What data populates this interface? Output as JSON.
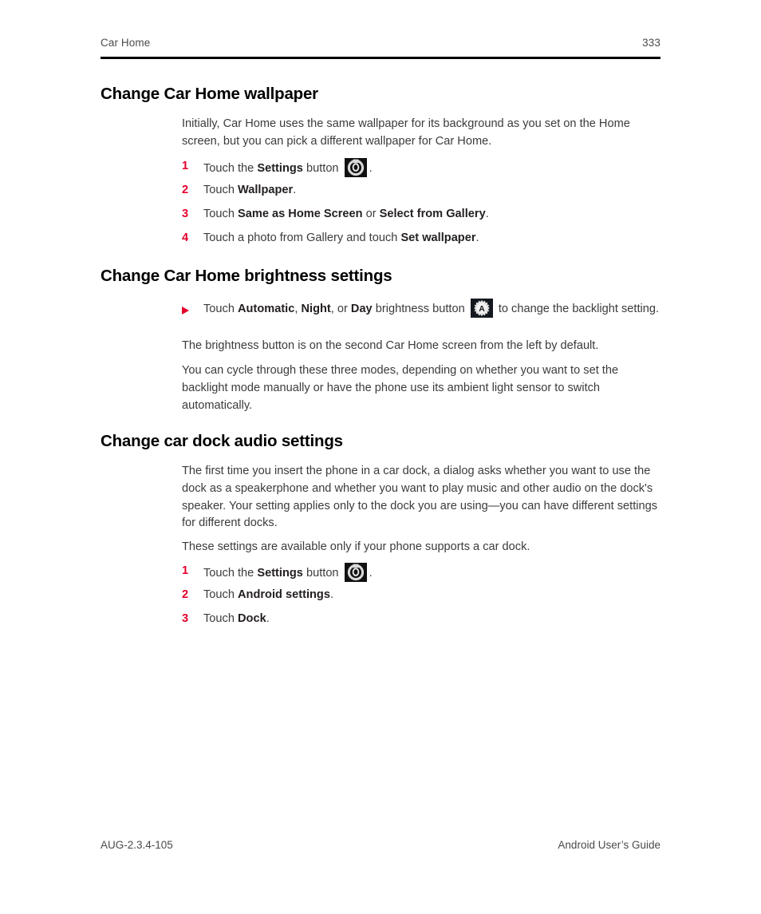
{
  "header": {
    "chapter": "Car Home",
    "page_number": "333"
  },
  "sections": {
    "wallpaper": {
      "heading": "Change Car Home wallpaper",
      "intro": "Initially, Car Home uses the same wallpaper for its background as you set on the Home screen, but you can pick a different wallpaper for Car Home.",
      "steps": [
        {
          "num": "1",
          "pre": "Touch the ",
          "bold": "Settings",
          "post": " button ",
          "icon": "settings-gear-icon",
          "tail": "."
        },
        {
          "num": "2",
          "pre": "Touch ",
          "bold": "Wallpaper",
          "post": "."
        },
        {
          "num": "3",
          "pre": "Touch ",
          "bold": "Same as Home Screen",
          "mid": " or ",
          "bold2": "Select from Gallery",
          "post": "."
        },
        {
          "num": "4",
          "pre": "Touch a photo from Gallery and touch ",
          "bold": "Set wallpaper",
          "post": "."
        }
      ]
    },
    "brightness": {
      "heading": "Change Car Home brightness settings",
      "bullet": {
        "pre": "Touch ",
        "bold1": "Automatic",
        "sep1": ", ",
        "bold2": "Night",
        "sep2": ", or ",
        "bold3": "Day",
        "mid": " brightness button ",
        "icon": "auto-brightness-icon",
        "post": " to change the backlight setting."
      },
      "note1": "The brightness button is on the second Car Home screen from the left by default.",
      "note2": "You can cycle through these three modes, depending on whether you want to set the backlight mode manually or have the phone use its ambient light sensor to switch automatically."
    },
    "dock": {
      "heading": "Change car dock audio settings",
      "para1": "The first time you insert the phone in a car dock, a dialog asks whether you want to use the dock as a speakerphone and whether you want to play music and other audio on the dock's speaker. Your setting applies only to the dock you are using—you can have different settings for different docks.",
      "para2": "These settings are available only if your phone supports a car dock.",
      "steps": [
        {
          "num": "1",
          "pre": "Touch the ",
          "bold": "Settings",
          "post": " button ",
          "icon": "settings-gear-icon",
          "tail": "."
        },
        {
          "num": "2",
          "pre": "Touch ",
          "bold": "Android settings",
          "post": "."
        },
        {
          "num": "3",
          "pre": "Touch ",
          "bold": "Dock",
          "post": "."
        }
      ]
    }
  },
  "footer": {
    "doc_id": "AUG-2.3.4-105",
    "guide_title": "Android User’s Guide"
  },
  "colors": {
    "accent_red": "#e4002b",
    "text": "#3b3b3b",
    "heading": "#000000",
    "rule": "#000000"
  }
}
